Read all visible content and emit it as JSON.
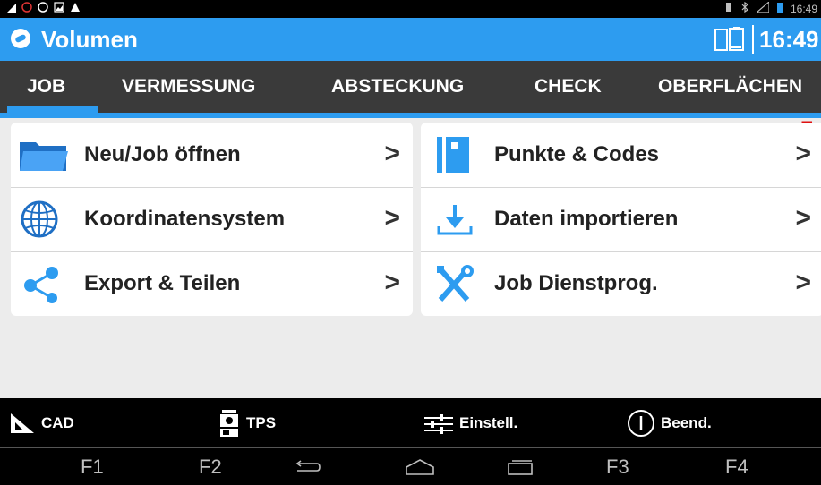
{
  "status_bar": {
    "time": "16:49"
  },
  "app": {
    "title": "Volumen",
    "clock": "16:49"
  },
  "tabs": [
    {
      "label": "JOB",
      "active": true
    },
    {
      "label": "VERMESSUNG",
      "active": false
    },
    {
      "label": "ABSTECKUNG",
      "active": false
    },
    {
      "label": "CHECK",
      "active": false
    },
    {
      "label": "OBERFLÄCHEN",
      "active": false
    }
  ],
  "left_menu": [
    {
      "label": "Neu/Job öffnen",
      "icon": "folder-icon"
    },
    {
      "label": "Koordinatensystem",
      "icon": "globe-icon"
    },
    {
      "label": "Export & Teilen",
      "icon": "share-icon"
    }
  ],
  "right_menu": [
    {
      "label": "Punkte & Codes",
      "icon": "points-book-icon"
    },
    {
      "label": "Daten importieren",
      "icon": "download-icon"
    },
    {
      "label": "Job Dienstprog.",
      "icon": "tools-icon"
    }
  ],
  "chevron": ">",
  "bottom_bar": {
    "cad": "CAD",
    "tps": "TPS",
    "settings": "Einstell.",
    "exit": "Beend."
  },
  "nav_bar": {
    "f1": "F1",
    "f2": "F2",
    "f3": "F3",
    "f4": "F4"
  },
  "colors": {
    "accent": "#2d9cf0",
    "tab_bar": "#3a3a3a",
    "background": "#ececec"
  }
}
